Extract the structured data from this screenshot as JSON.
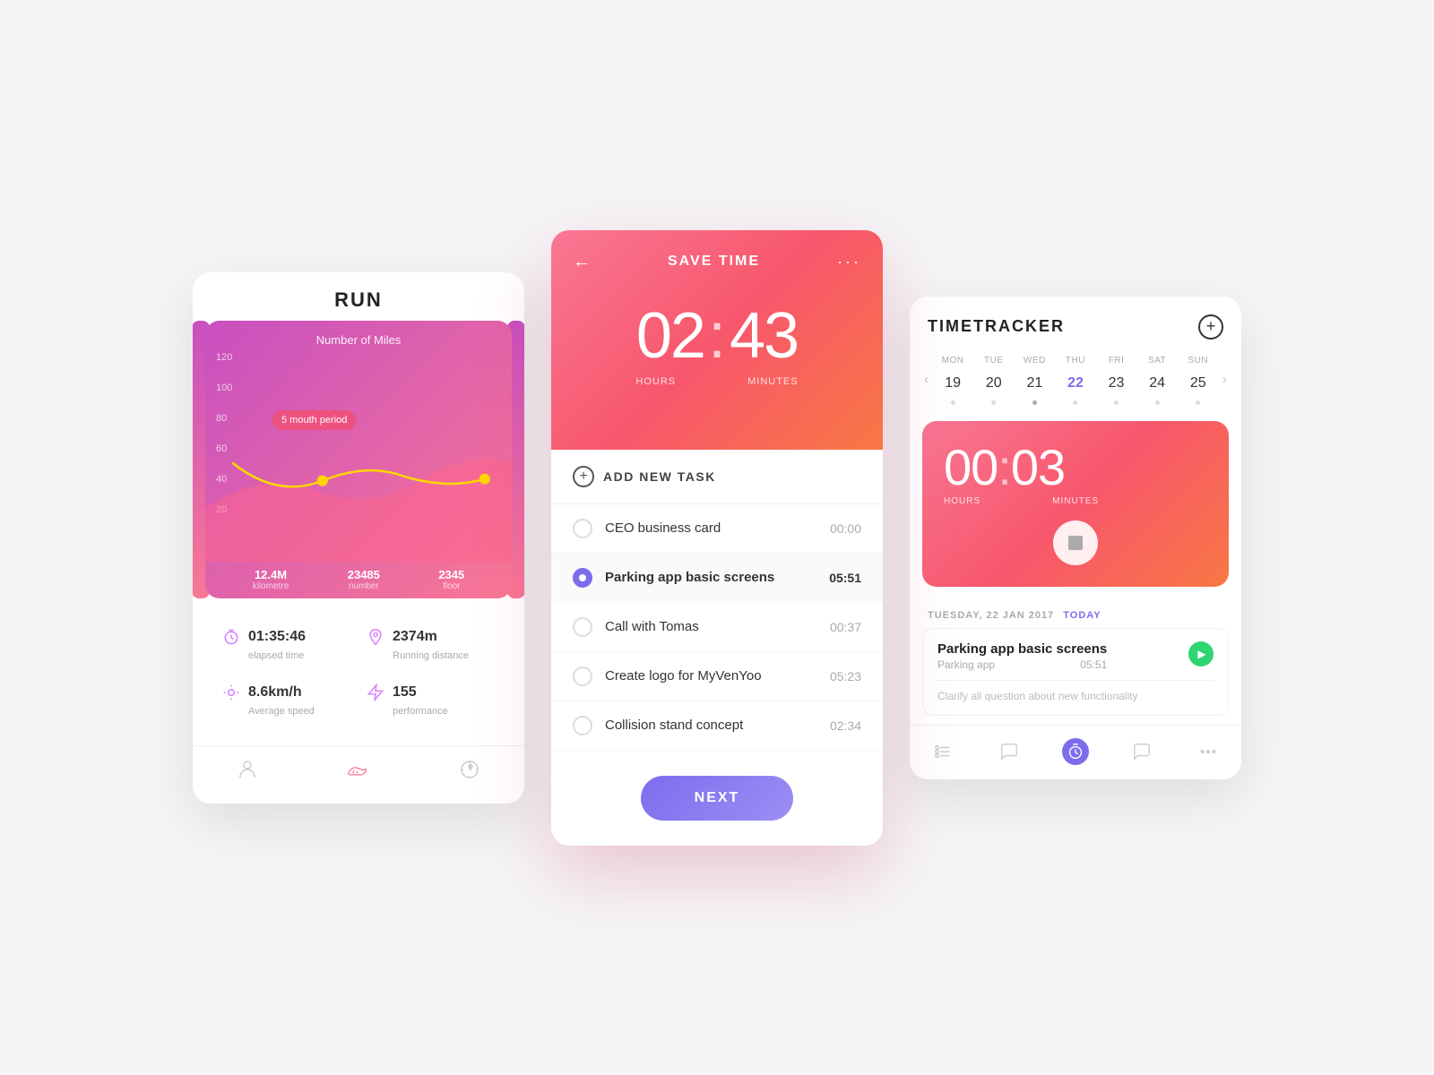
{
  "run_app": {
    "title": "RUN",
    "chart": {
      "title": "Number of Miles",
      "y_labels": [
        "120",
        "100",
        "80",
        "60",
        "40",
        "20"
      ],
      "tooltip": "5 mouth period",
      "bottom_stats": [
        {
          "value": "12.4M",
          "label": "kilometre"
        },
        {
          "value": "23485",
          "label": "number"
        },
        {
          "value": "2345",
          "label": "floor"
        }
      ]
    },
    "stats": [
      {
        "icon": "timer",
        "value": "01:35:46",
        "label": "elapsed time"
      },
      {
        "icon": "location",
        "value": "2374m",
        "label": "Running distance"
      },
      {
        "icon": "speed",
        "value": "8.6km/h",
        "label": "Average speed"
      },
      {
        "icon": "lightning",
        "value": "155",
        "label": "performance"
      }
    ],
    "nav": [
      "person",
      "shoe",
      "compass"
    ]
  },
  "save_app": {
    "header": {
      "title": "SAVE TIME",
      "back_label": "←",
      "more_label": "···"
    },
    "timer": {
      "hours": "02",
      "minutes": "43",
      "hours_label": "HOURS",
      "minutes_label": "MINUTES"
    },
    "add_task_label": "ADD NEW TASK",
    "tasks": [
      {
        "name": "CEO business card",
        "time": "00:00",
        "active": false
      },
      {
        "name": "Parking app basic screens",
        "time": "05:51",
        "active": true
      },
      {
        "name": "Call with Tomas",
        "time": "00:37",
        "active": false
      },
      {
        "name": "Create logo for MyVenYoo",
        "time": "05:23",
        "active": false
      },
      {
        "name": "Collision stand concept",
        "time": "02:34",
        "active": false
      }
    ],
    "next_button": "NEXT"
  },
  "tracker_app": {
    "title": "TIMETRACKER",
    "add_button": "+",
    "calendar": {
      "prev_arrow": "‹",
      "next_arrow": "›",
      "days": [
        {
          "name": "MON",
          "num": "19",
          "active": false,
          "has_dot": false
        },
        {
          "name": "TUE",
          "num": "20",
          "active": false,
          "has_dot": false
        },
        {
          "name": "WED",
          "num": "21",
          "active": false,
          "has_dot": true
        },
        {
          "name": "THU",
          "num": "22",
          "active": true,
          "has_dot": false
        },
        {
          "name": "FRI",
          "num": "23",
          "active": false,
          "has_dot": false
        },
        {
          "name": "SAT",
          "num": "24",
          "active": false,
          "has_dot": false
        },
        {
          "name": "SUN",
          "num": "25",
          "active": false,
          "has_dot": false
        }
      ]
    },
    "timer": {
      "hours": "00",
      "minutes": "03",
      "hours_label": "HOURS",
      "minutes_label": "MINUTES"
    },
    "date_label": "TUESDAY, 22 JAN 2017",
    "today_badge": "TODAY",
    "task_card": {
      "name": "Parking app basic screens",
      "sub": "Parking app",
      "time": "05:51",
      "description": "Clarify all question about new functionality"
    }
  }
}
